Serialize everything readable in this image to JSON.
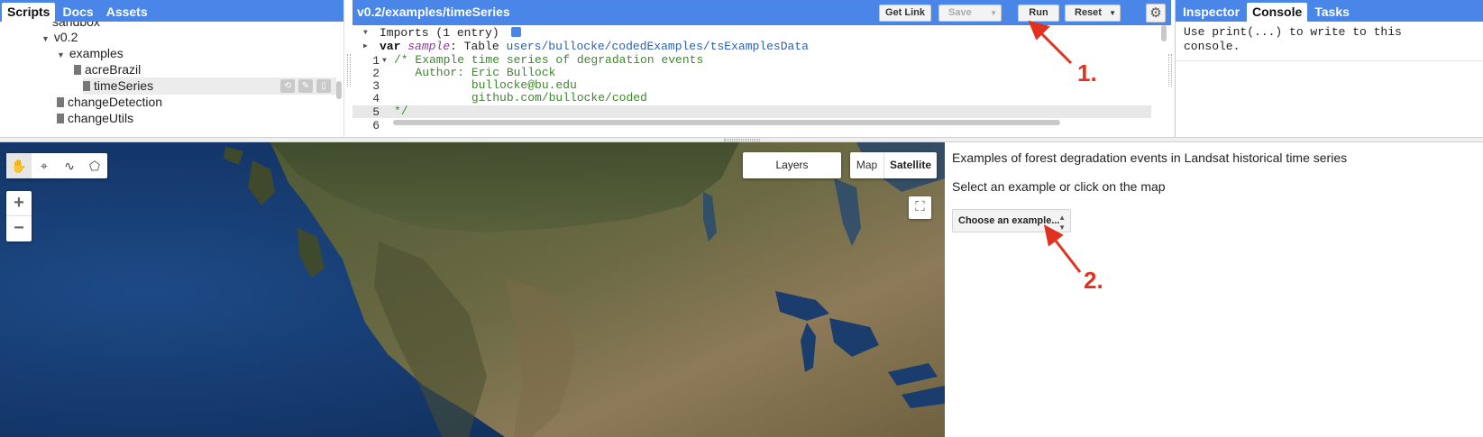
{
  "left_panel": {
    "tabs": [
      "Scripts",
      "Docs",
      "Assets"
    ],
    "tree": [
      {
        "label": "sandbox",
        "type": "folder"
      },
      {
        "label": "v0.2",
        "type": "folder"
      },
      {
        "label": "examples",
        "type": "folder"
      },
      {
        "label": "acreBrazil",
        "type": "file"
      },
      {
        "label": "timeSeries",
        "type": "file",
        "selected": true
      },
      {
        "label": "changeDetection",
        "type": "file"
      },
      {
        "label": "changeUtils",
        "type": "file"
      }
    ]
  },
  "editor": {
    "path": "v0.2/examples/timeSeries",
    "buttons": {
      "get_link": "Get Link",
      "save": "Save",
      "run": "Run",
      "reset": "Reset"
    },
    "imports_header": "Imports (1 entry)",
    "import_keyword": "var",
    "import_name": "sample",
    "import_type": "Table",
    "import_path": "users/bullocke/codedExamples/tsExamplesData",
    "lines": [
      {
        "num": "1",
        "text": "/* Example time series of degradation events"
      },
      {
        "num": "2",
        "text": "   Author: Eric Bullock"
      },
      {
        "num": "3",
        "text": "           bullocke@bu.edu"
      },
      {
        "num": "4",
        "text": "           github.com/bullocke/coded"
      },
      {
        "num": "5",
        "text": "*/"
      },
      {
        "num": "6",
        "text": ""
      }
    ]
  },
  "right_panel": {
    "tabs": [
      "Inspector",
      "Console",
      "Tasks"
    ],
    "console_text": "Use print(...) to write to this\nconsole."
  },
  "map": {
    "layers_label": "Layers",
    "map_label": "Map",
    "satellite_label": "Satellite",
    "zoom_in": "+",
    "zoom_out": "−"
  },
  "side_panel": {
    "title": "Examples of forest degradation events in Landsat historical time series",
    "subtitle": "Select an example or click on the map",
    "select_value": "Choose an example..."
  },
  "annotations": {
    "step1": "1.",
    "step2": "2."
  },
  "colors": {
    "accent": "#4a86e8",
    "annotation": "#e0321f",
    "code_comment": "#3a8a2a"
  }
}
